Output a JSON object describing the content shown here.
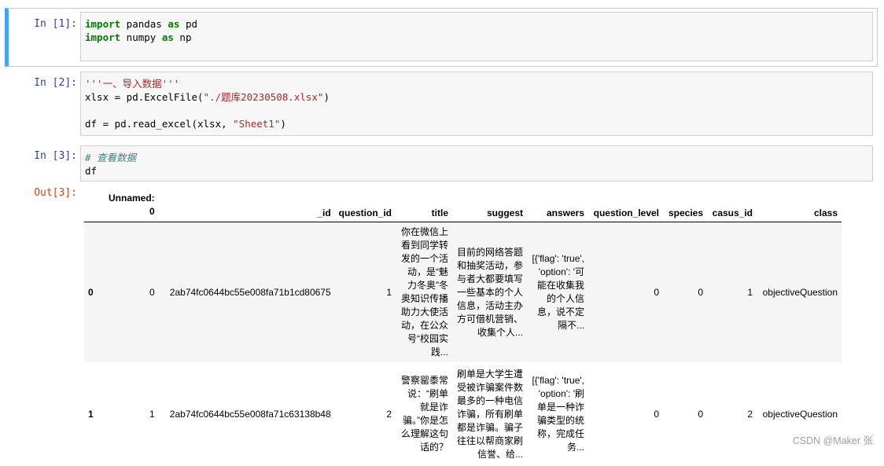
{
  "cells": [
    {
      "prompt": "In  [1]:",
      "lines": [
        [
          {
            "t": "import",
            "c": "kw"
          },
          {
            "t": " pandas "
          },
          {
            "t": "as",
            "c": "kw"
          },
          {
            "t": " pd"
          }
        ],
        [
          {
            "t": "import",
            "c": "kw"
          },
          {
            "t": " numpy "
          },
          {
            "t": "as",
            "c": "kw"
          },
          {
            "t": " np"
          }
        ]
      ]
    },
    {
      "prompt": "In  [2]:",
      "lines": [
        [
          {
            "t": "'''一、导入数据'''",
            "c": "str"
          }
        ],
        [
          {
            "t": "xlsx = pd.ExcelFile("
          },
          {
            "t": "\"./题库20230508.xlsx\"",
            "c": "str"
          },
          {
            "t": ")"
          }
        ],
        [
          {
            "t": " "
          }
        ],
        [
          {
            "t": "df = pd.read_excel(xlsx, "
          },
          {
            "t": "\"Sheet1\"",
            "c": "str"
          },
          {
            "t": ")"
          }
        ]
      ]
    },
    {
      "prompt": "In  [3]:",
      "lines": [
        [
          {
            "t": "# 查看数据",
            "c": "com"
          }
        ],
        [
          {
            "t": "df"
          }
        ]
      ]
    }
  ],
  "output_prompt": "Out[3]:",
  "table": {
    "columns": [
      "",
      "Unnamed: 0",
      "_id",
      "question_id",
      "title",
      "suggest",
      "answers",
      "question_level",
      "species",
      "casus_id",
      "class"
    ],
    "rows": [
      [
        "0",
        "0",
        "2ab74fc0644bc55e008fa71b1cd80675",
        "1",
        "你在微信上看到同学转发的一个活动，是“魅力冬奥”冬奥知识传播助力大使活动，在公众号“校园实践...",
        "目前的网络答题和抽奖活动，参与者大都要填写一些基本的个人信息，活动主办方可借机营销、收集个人...",
        "[{'flag': 'true', 'option': '可能在收集我的个人信息，说不定隔不...",
        "0",
        "0",
        "1",
        "objectiveQuestion"
      ],
      [
        "1",
        "1",
        "2ab74fc0644bc55e008fa71c63138b48",
        "2",
        "警察罂黍常说：“刷单就是诈骗。”你是怎么理解这句话的？",
        "刷单是大学生遭受被诈骗案件数最多的一种电信诈骗，所有刷单都是诈骗。骗子往往以帮商家刷信誉、给...",
        "[{'flag': 'true', 'option': '刷单是一种诈骗类型的统称，完成任务...",
        "0",
        "0",
        "2",
        "objectiveQuestion"
      ]
    ]
  },
  "watermark": "CSDN @Maker 张"
}
